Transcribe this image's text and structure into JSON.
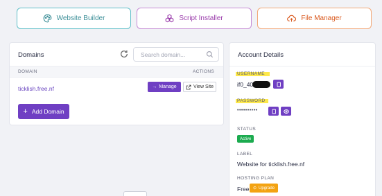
{
  "quick_actions": {
    "website_builder": "Website Builder",
    "script_installer": "Script Installer",
    "file_manager": "File Manager"
  },
  "domains": {
    "title": "Domains",
    "search_placeholder": "Search domain...",
    "columns": [
      "DOMAIN",
      "ACTIONS"
    ],
    "rows": [
      {
        "domain": "ticklish.free.nf",
        "manage_label": "Manage",
        "view_label": "View Site"
      }
    ],
    "add_label": "Add Domain"
  },
  "account": {
    "title": "Account Details",
    "username_label": "USERNAME",
    "username_value": "if0_40",
    "password_label": "PASSWORD",
    "password_value": "••••••••••",
    "status_label": "STATUS",
    "status_value": "Active",
    "label_label": "LABEL",
    "label_value": "Website for ticklish.free.nf",
    "plan_label": "HOSTING PLAN",
    "plan_value": "Free",
    "upgrade_label": "Upgrade"
  },
  "colors": {
    "accent": "#6f3fc3",
    "highlight": "#fde84a",
    "success": "#1bab4f",
    "warning": "#f3a312"
  }
}
